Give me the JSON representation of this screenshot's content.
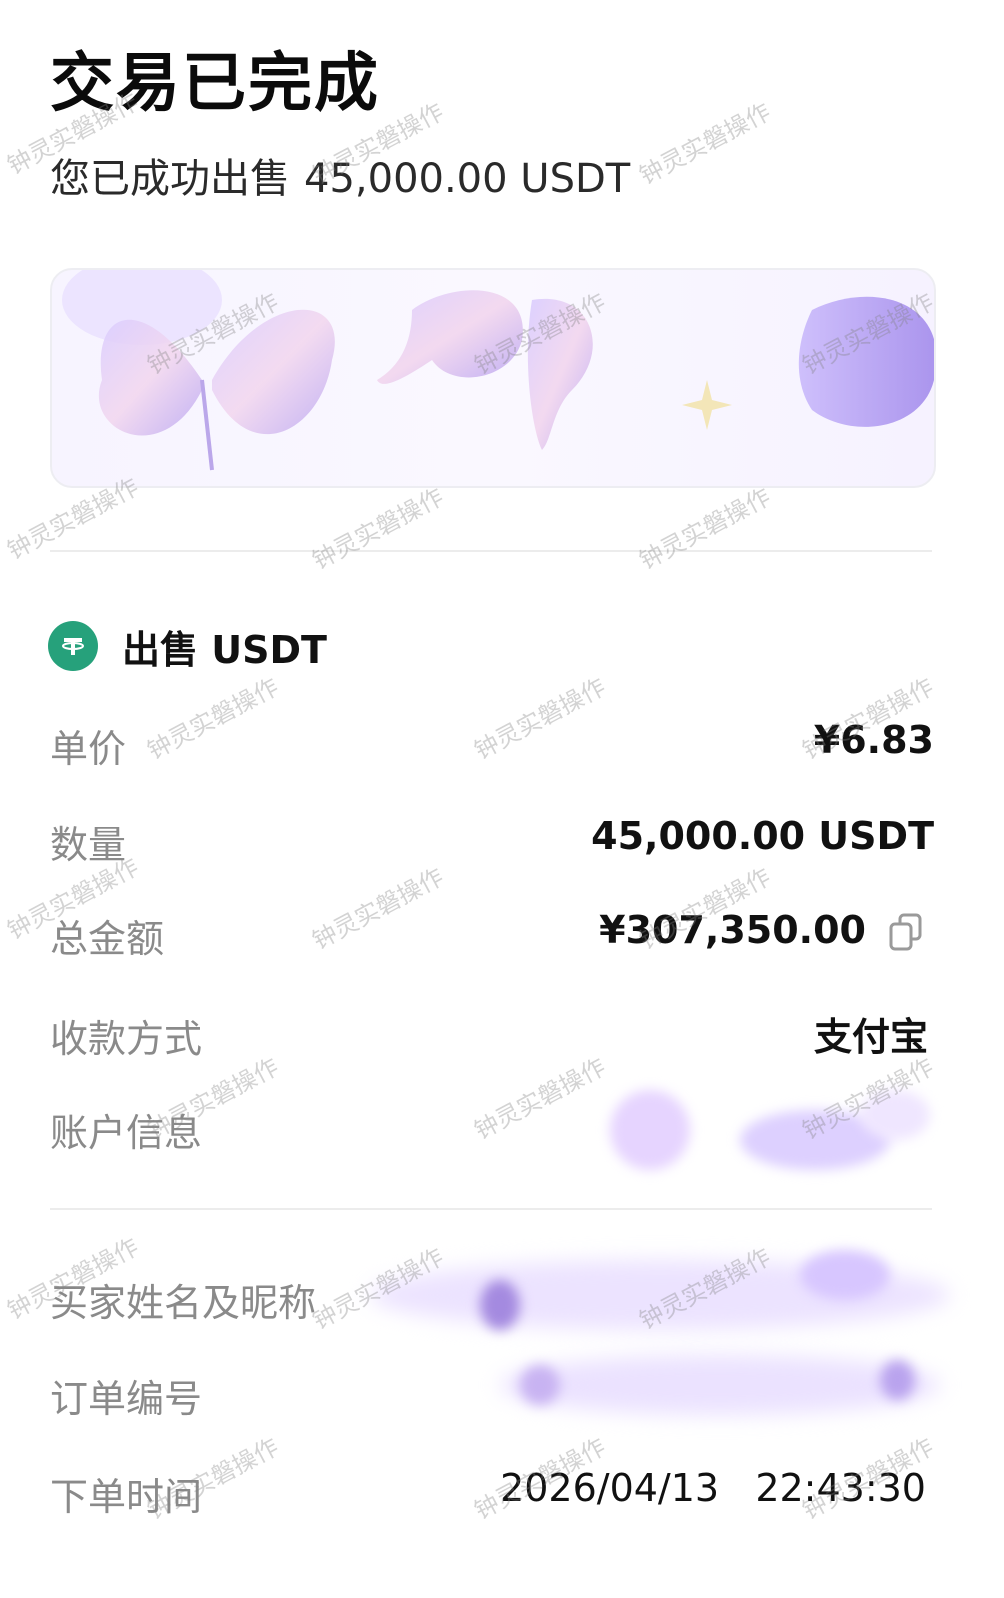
{
  "header": {
    "title": "交易已完成",
    "subtitle_prefix": "您已成功出售",
    "subtitle_amount": "45,000.00 USDT"
  },
  "order": {
    "section_title": "出售 USDT",
    "rows": [
      {
        "label": "单价",
        "value": "¥6.83"
      },
      {
        "label": "数量",
        "value": "45,000.00 USDT"
      },
      {
        "label": "总金额",
        "value": "¥307,350.00"
      },
      {
        "label": "收款方式",
        "value": "支付宝"
      },
      {
        "label": "账户信息",
        "value": ""
      }
    ]
  },
  "details": {
    "rows": [
      {
        "label": "买家姓名及昵称",
        "value": ""
      },
      {
        "label": "订单编号",
        "value": ""
      },
      {
        "label": "下单时间",
        "value": "2026/04/13   22:43:30"
      }
    ]
  },
  "watermark": "钟灵实磐操作",
  "colors": {
    "tether": "#26a17b",
    "label": "#8a8a8a",
    "value": "#111111",
    "banner_tint": "#efe8ff"
  },
  "icons": [
    "tether-icon",
    "copy-icon",
    "butterfly-sticker"
  ]
}
